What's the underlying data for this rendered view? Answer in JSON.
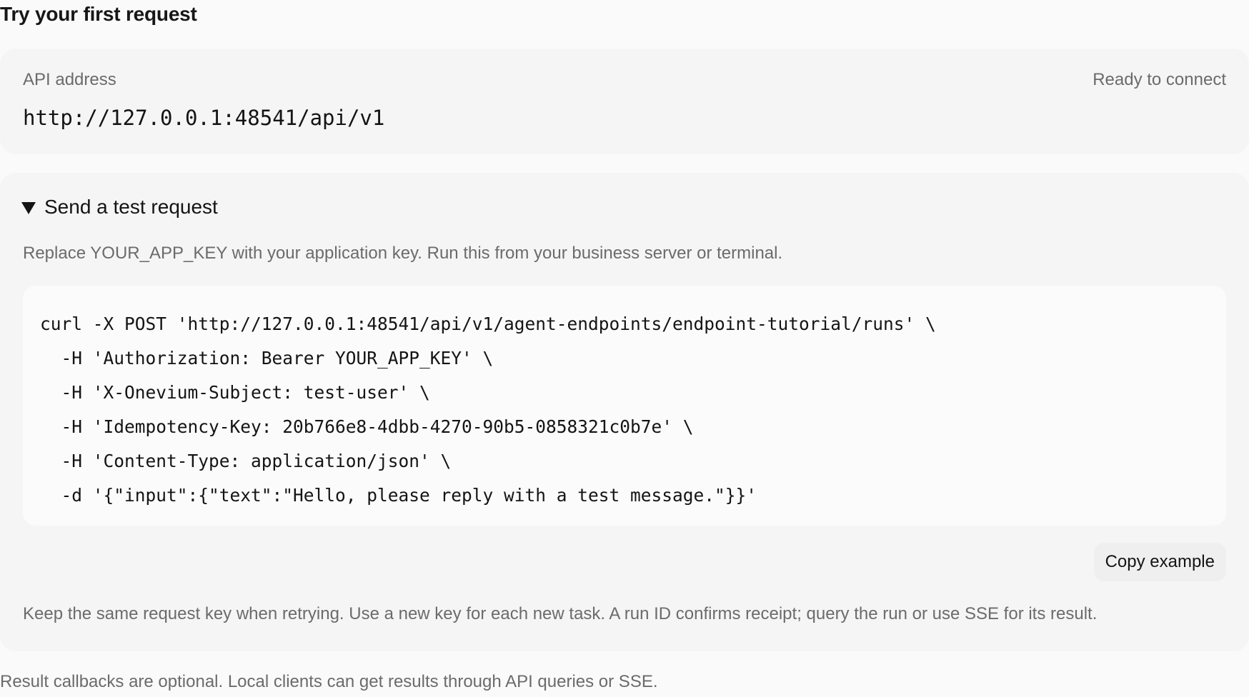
{
  "heading": "Try your first request",
  "api_address": {
    "label": "API address",
    "status": "Ready to connect",
    "value": "http://127.0.0.1:48541/api/v1"
  },
  "test_request": {
    "summary_label": "Send a test request",
    "description": "Replace YOUR_APP_KEY with your application key. Run this from your business server or terminal.",
    "code_lines": [
      "curl -X POST 'http://127.0.0.1:48541/api/v1/agent-endpoints/endpoint-tutorial/runs' \\",
      "  -H 'Authorization: Bearer YOUR_APP_KEY' \\",
      "  -H 'X-Onevium-Subject: test-user' \\",
      "  -H 'Idempotency-Key: 20b766e8-4dbb-4270-90b5-0858321c0b7e' \\",
      "  -H 'Content-Type: application/json' \\",
      "  -d '{\"input\":{\"text\":\"Hello, please reply with a test message.\"}}'"
    ],
    "copy_label": "Copy example",
    "note": "Keep the same request key when retrying. Use a new key for each new task. A run ID confirms receipt; query the run or use SSE for its result."
  },
  "footer_note": "Result callbacks are optional. Local clients can get results through API queries or SSE."
}
